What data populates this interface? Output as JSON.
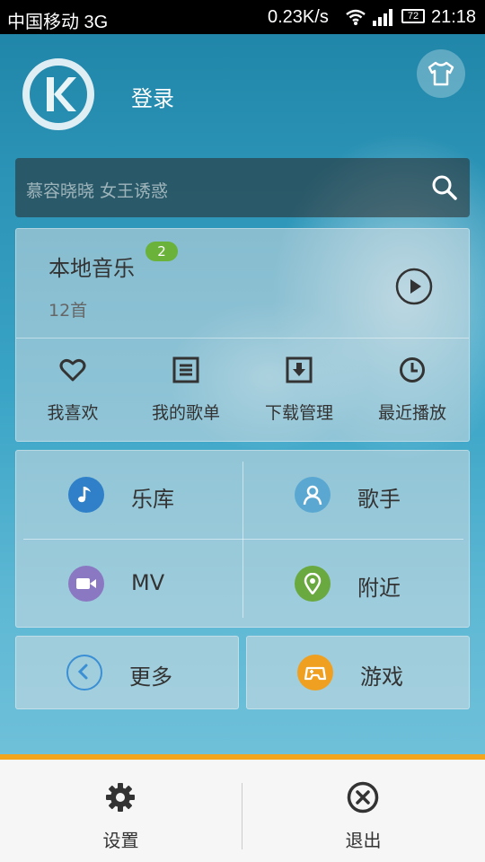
{
  "status_bar": {
    "carrier": "中国移动 3G",
    "speed": "0.23K/s",
    "battery": "72",
    "time": "21:18"
  },
  "header": {
    "login_label": "登录",
    "logo_icon": "kugou-k-logo",
    "skin_icon": "tshirt-icon"
  },
  "search": {
    "placeholder": "慕容晓晓  女王诱惑"
  },
  "local_music": {
    "title": "本地音乐",
    "badge": "2",
    "count": "12首",
    "quick_actions": [
      {
        "label": "我喜欢",
        "icon": "heart-icon"
      },
      {
        "label": "我的歌单",
        "icon": "playlist-icon"
      },
      {
        "label": "下载管理",
        "icon": "download-icon"
      },
      {
        "label": "最近播放",
        "icon": "clock-icon"
      }
    ]
  },
  "grid": [
    {
      "label": "乐库",
      "icon": "music-note-icon",
      "color": "#2f80c9"
    },
    {
      "label": "歌手",
      "icon": "singer-icon",
      "color": "#5aa8d2"
    },
    {
      "label": "MV",
      "icon": "video-camera-icon",
      "color": "#8b78c2"
    },
    {
      "label": "附近",
      "icon": "location-pin-icon",
      "color": "#6aa840"
    }
  ],
  "more": {
    "label": "更多",
    "icon": "chevron-left-icon",
    "color": "#3b8fd4"
  },
  "game": {
    "label": "游戏",
    "icon": "gamepad-icon",
    "color": "#f0a020"
  },
  "bottom_menu": {
    "settings_label": "设置",
    "exit_label": "退出",
    "accent": "#f3a51d"
  }
}
